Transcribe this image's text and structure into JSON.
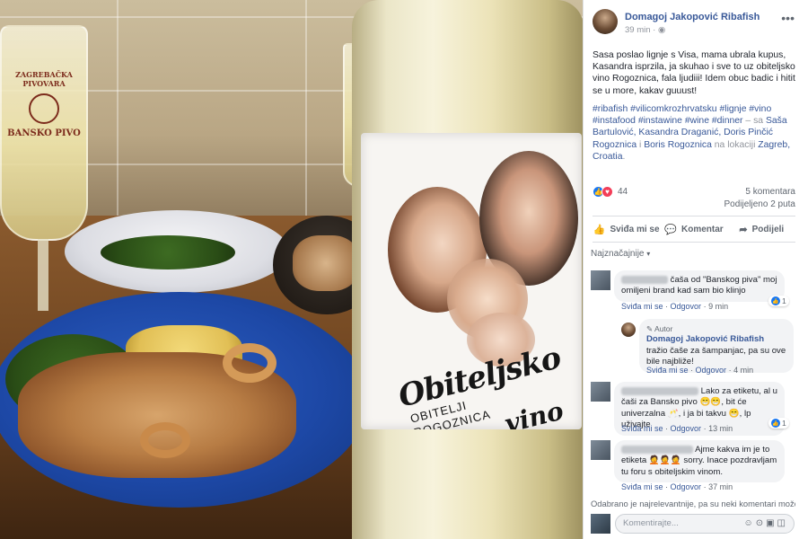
{
  "photo": {
    "glass_logo": "BANSKO PIVO",
    "glass_logo_top": "ZAGREBAČKA PIVOVARA",
    "label_title_1": "Obiteljsko",
    "label_title_2": "vino",
    "label_sub_1": "OBITELJI",
    "label_sub_2": "ROGOZNICA"
  },
  "post": {
    "author": "Domagoj Jakopović Ribafish",
    "time": "39 min",
    "privacy_icon": "globe-icon",
    "more_icon": "•••",
    "text": "Sasa poslao lignje s Visa, mama ubrala kupus, Kasandra isprzila, ja skuhao i sve to uz obiteljsko vino Rogoznica, fala ljudiii! Idem obuc badic i hitit se u more, kakav guuust!",
    "tags": "#ribafish #vilicomkrozhrvatsku #lignje #vino #instafood #instawine #wine #dinner",
    "with_prefix": " – sa ",
    "with_people": "Saša Bartulović, Kasandra Draganić, Doris Pinčić Rogoznica",
    "and_word": " i ",
    "last_person": "Boris Rogoznica",
    "location_prefix": " na lokaciji ",
    "location": "Zagreb, Croatia",
    "location_suffix": "."
  },
  "reactions": {
    "count": "44",
    "comments": "5 komentara",
    "shares": "Podijeljeno 2 puta"
  },
  "actions": {
    "like": "Sviđa mi se",
    "comment": "Komentar",
    "share": "Podijeli"
  },
  "sort": {
    "label": "Najznačajnije"
  },
  "comments": [
    {
      "text": "čaša od \"Banskog piva\" moj omiljeni brand kad sam bio klinjo",
      "like": "Sviđa mi se",
      "reply": "Odgovor",
      "time": "9 min",
      "likes": "1"
    },
    {
      "badge": "Autor",
      "name": "Domagoj Jakopović Ribafish",
      "text": " tražio čaše za šampanjac, pa su ove bile najbliže!",
      "like": "Sviđa mi se",
      "reply": "Odgovor",
      "time": "4 min"
    },
    {
      "text": "Lako za etiketu, al u čaši za Bansko pivo 😁😁, bit će univerzalna 🥂, i ja bi takvu 😁, lp uživajte",
      "like": "Sviđa mi se",
      "reply": "Odgovor",
      "time": "13 min",
      "likes": "1"
    },
    {
      "text": "Ajme kakva im je to etiketa 🤦🤦🤦 sorry. Inace pozdravljam tu foru s obiteljskim vinom.",
      "like": "Sviđa mi se",
      "reply": "Odgovor",
      "time": "37 min"
    }
  ],
  "footer": {
    "note": "Odabrano je najrelevantnije, pa su neki komentari možda",
    "composer_placeholder": "Komentirajte..."
  }
}
